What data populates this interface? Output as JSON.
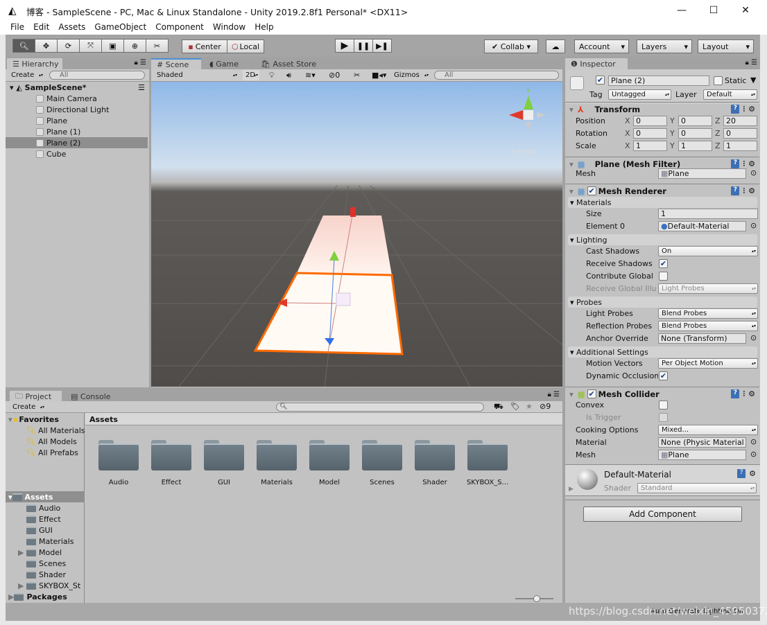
{
  "window": {
    "title": "博客 - SampleScene - PC, Mac & Linux Standalone - Unity 2019.2.8f1 Personal* <DX11>",
    "minimize": "—",
    "maximize": "☐",
    "close": "✕"
  },
  "menu": [
    "File",
    "Edit",
    "Assets",
    "GameObject",
    "Component",
    "Window",
    "Help"
  ],
  "toolbar": {
    "tools": [
      "hand-tool",
      "move-tool",
      "rotate-tool",
      "scale-tool",
      "rect-tool",
      "transform-tool",
      "custom-tool"
    ],
    "active_tool": 0,
    "pivot": "Center",
    "space": "Local",
    "collab": "Collab",
    "account": "Account",
    "layers": "Layers",
    "layout": "Layout"
  },
  "hierarchy": {
    "tab": "Hierarchy",
    "create": "Create",
    "search_placeholder": "All",
    "scene": "SampleScene*",
    "items": [
      "Main Camera",
      "Directional Light",
      "Plane",
      "Plane (1)",
      "Plane (2)",
      "Cube"
    ],
    "selected": 4
  },
  "scene": {
    "tabs": [
      "Scene",
      "Game",
      "Asset Store"
    ],
    "shading": "Shaded",
    "mode_2d": "2D",
    "hidden_count": "0",
    "gizmos": "Gizmos",
    "search_placeholder": "All",
    "projection": "Persp",
    "gizmo_axes": {
      "y": "y"
    }
  },
  "inspector": {
    "tab": "Inspector",
    "object_name": "Plane (2)",
    "active": true,
    "static_label": "Static",
    "tag_label": "Tag",
    "tag": "Untagged",
    "layer_label": "Layer",
    "layer": "Default",
    "transform": {
      "title": "Transform",
      "rows": [
        {
          "label": "Position",
          "x": "0",
          "y": "0",
          "z": "20"
        },
        {
          "label": "Rotation",
          "x": "0",
          "y": "0",
          "z": "0"
        },
        {
          "label": "Scale",
          "x": "1",
          "y": "1",
          "z": "1"
        }
      ],
      "axes": [
        "X",
        "Y",
        "Z"
      ]
    },
    "mesh_filter": {
      "title": "Plane (Mesh Filter)",
      "mesh_label": "Mesh",
      "mesh": "Plane"
    },
    "mesh_renderer": {
      "title": "Mesh Renderer",
      "enabled": true,
      "materials": "Materials",
      "size_label": "Size",
      "size": "1",
      "element_label": "Element 0",
      "element": "Default-Material",
      "lighting": "Lighting",
      "cast_shadows_label": "Cast Shadows",
      "cast_shadows": "On",
      "receive_shadows_label": "Receive Shadows",
      "receive_shadows": true,
      "contribute_gi_label": "Contribute Global",
      "contribute_gi": false,
      "receive_gi_label": "Receive Global Illu",
      "receive_gi": "Light Probes",
      "probes": "Probes",
      "light_probes_label": "Light Probes",
      "light_probes": "Blend Probes",
      "reflection_probes_label": "Reflection Probes",
      "reflection_probes": "Blend Probes",
      "anchor_label": "Anchor Override",
      "anchor": "None (Transform)",
      "additional": "Additional Settings",
      "motion_vectors_label": "Motion Vectors",
      "motion_vectors": "Per Object Motion",
      "dynamic_occlusion_label": "Dynamic Occlusion",
      "dynamic_occlusion": true
    },
    "mesh_collider": {
      "title": "Mesh Collider",
      "enabled": true,
      "convex_label": "Convex",
      "convex": false,
      "trigger_label": "Is Trigger",
      "trigger": false,
      "cooking_label": "Cooking Options",
      "cooking": "Mixed...",
      "material_label": "Material",
      "material": "None (Physic Material",
      "mesh_label": "Mesh",
      "mesh": "Plane"
    },
    "material": {
      "name": "Default-Material",
      "shader_label": "Shader",
      "shader": "Standard"
    },
    "add_component": "Add Component"
  },
  "project": {
    "tabs": [
      "Project",
      "Console"
    ],
    "create": "Create",
    "hidden_count": "9",
    "favorites": "Favorites",
    "fav_items": [
      "All Materials",
      "All Models",
      "All Prefabs"
    ],
    "assets": "Assets",
    "asset_folders": [
      "Audio",
      "Effect",
      "GUI",
      "Materials",
      "Model",
      "Scenes",
      "Shader",
      "SKYBOX_St"
    ],
    "packages": "Packages",
    "breadcrumb": "Assets",
    "grid": [
      "Audio",
      "Effect",
      "GUI",
      "Materials",
      "Model",
      "Scenes",
      "Shader",
      "SKYBOX_S..."
    ]
  },
  "status": {
    "text": "Auto Generate Lighting On",
    "watermark": "https://blog.csdn.net/weixin_45950372"
  },
  "colors": {
    "selection": "#ff6a00",
    "accent": "#4a90d9"
  }
}
